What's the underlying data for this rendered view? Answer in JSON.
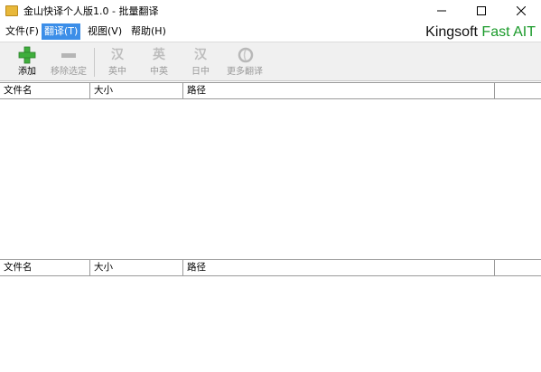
{
  "window": {
    "title": "金山快译个人版1.0 - 批量翻译"
  },
  "menu": {
    "items": [
      {
        "label": "文件(F)",
        "active": false
      },
      {
        "label": "翻译(T)",
        "active": true
      },
      {
        "label": "视图(V)",
        "active": false
      },
      {
        "label": "帮助(H)",
        "active": false
      }
    ],
    "brand": {
      "main": "Kingsoft ",
      "accent": "Fast AIT"
    }
  },
  "toolbar": {
    "add_label": "添加",
    "remove_label": "移除选定",
    "en_zh_label": "英中",
    "zh_en_label": "中英",
    "ja_zh_label": "日中",
    "more_label": "更多翻译"
  },
  "upper_list": {
    "columns": [
      "文件名",
      "大小",
      "路径",
      ""
    ]
  },
  "lower_list": {
    "columns": [
      "文件名",
      "大小",
      "路径",
      ""
    ]
  },
  "colors": {
    "menu_active": "#3c8ee8",
    "brand_accent": "#1a9a2a",
    "add_icon": "#3fae3c"
  }
}
